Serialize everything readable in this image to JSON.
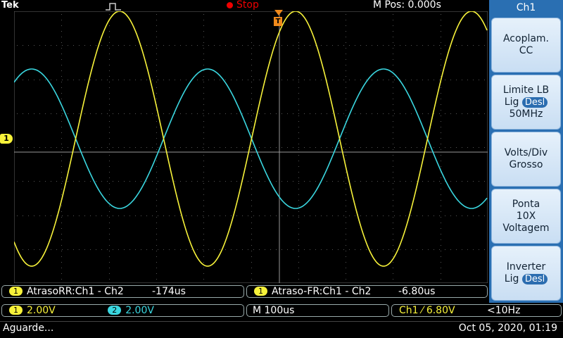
{
  "header": {
    "brand": "Tek",
    "run_state": "Stop",
    "m_pos": "M Pos: 0.000s"
  },
  "menu": {
    "title": "Ch1",
    "buttons": [
      {
        "line1": "Acoplam.",
        "line2": "CC"
      },
      {
        "line1": "Limite LB",
        "line2_prefix": "Lig",
        "line2_pill": "Desl",
        "line3": "50MHz"
      },
      {
        "line1": "Volts/Div",
        "line2": "Grosso"
      },
      {
        "line1": "Ponta",
        "line2": "10X",
        "line3": "Voltagem"
      },
      {
        "line1": "Inverter",
        "line2_prefix": "Lig",
        "line2_pill": "Desl"
      }
    ]
  },
  "markers": {
    "ch1_level": "1",
    "trigger_pos": "T"
  },
  "measurements": [
    {
      "channel": "1",
      "label": "AtrasoRR:Ch1 - Ch2",
      "value": "-174us"
    },
    {
      "channel": "1",
      "label": "Atraso-FR:Ch1 - Ch2",
      "value": "-6.80us"
    }
  ],
  "channels": {
    "ch1": {
      "badge": "1",
      "scale": "2.00V"
    },
    "ch2": {
      "badge": "2",
      "scale": "2.00V"
    }
  },
  "timebase": "M 100us",
  "trigger": {
    "source": "Ch1",
    "slope": "⁄",
    "level": "6.80V",
    "freq": "<10Hz"
  },
  "status": {
    "message": "Aguarde...",
    "datetime": "Oct 05, 2020, 01:19"
  },
  "colors": {
    "ch1": "#f7f23a",
    "ch2": "#3ad7e0",
    "menu": "#2a6fb2",
    "stop": "#e00000"
  }
}
